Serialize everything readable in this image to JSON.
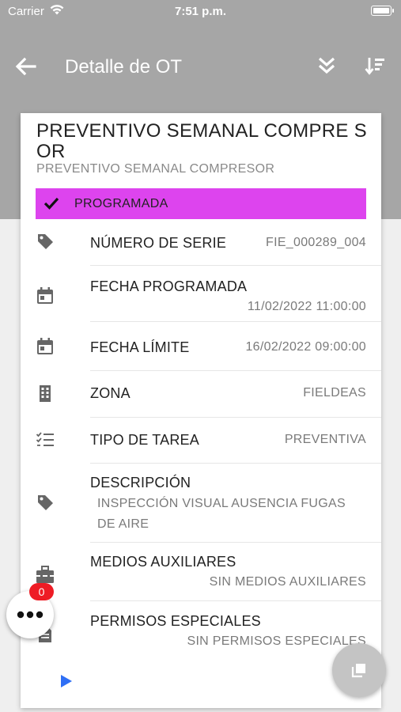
{
  "status_bar": {
    "carrier": "Carrier",
    "time": "7:51 p.m."
  },
  "app_bar": {
    "title": "Detalle de OT"
  },
  "card": {
    "title": "PREVENTIVO SEMANAL COMPRESOR",
    "title_display": "PREVENTIVO SEMANAL COMPRE SOR",
    "subtitle": "PREVENTIVO SEMANAL COMPRESOR",
    "state": {
      "label": "PROGRAMADA",
      "color": "#dd44ee"
    },
    "fields": [
      {
        "icon": "tag-icon",
        "label": "NÚMERO DE SERIE",
        "value": "FIE_000289_004"
      },
      {
        "icon": "calendar-icon",
        "label": "FECHA PROGRAMADA",
        "value": "11/02/2022 11:00:00"
      },
      {
        "icon": "calendar-icon",
        "label": "FECHA LÍMITE",
        "value": "16/02/2022 09:00:00"
      },
      {
        "icon": "building-icon",
        "label": "ZONA",
        "value": "FIELDEAS"
      },
      {
        "icon": "checklist-icon",
        "label": "TIPO DE TAREA",
        "value": "PREVENTIVA"
      },
      {
        "icon": "tag-icon",
        "label": "DESCRIPCIÓN",
        "value": "INSPECCIÓN VISUAL AUSENCIA FUGAS DE AIRE"
      },
      {
        "icon": "toolbox-icon",
        "label": "MEDIOS AUXILIARES",
        "value": "SIN MEDIOS AUXILIARES"
      },
      {
        "icon": "document-icon",
        "label": "PERMISOS ESPECIALES",
        "value": "SIN PERMISOS ESPECIALES"
      }
    ]
  },
  "fab": {
    "badge_count": "0"
  },
  "colors": {
    "header_bg": "#a6a6a6",
    "state_bg": "#dd44ee",
    "badge_bg": "#ee1c25",
    "play_icon": "#2f6ff5"
  }
}
